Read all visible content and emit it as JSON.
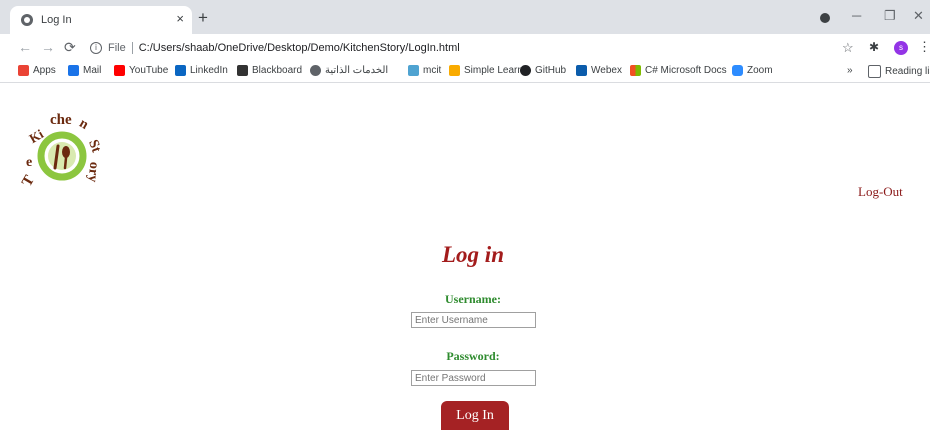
{
  "browser": {
    "tab_title": "Log In",
    "tab_close": "×",
    "new_tab": "+",
    "omnibox": {
      "scheme_label": "File",
      "url": "C:/Users/shaab/OneDrive/Desktop/Demo/KitchenStory/LogIn.html"
    },
    "bookmarks": [
      {
        "label": "Apps",
        "icon": "apps-grid-icon",
        "color": "#ea4335"
      },
      {
        "label": "Mail",
        "icon": "mail-icon",
        "color": "#1a73e8"
      },
      {
        "label": "YouTube",
        "icon": "youtube-icon",
        "color": "#ff0000"
      },
      {
        "label": "LinkedIn",
        "icon": "linkedin-icon",
        "color": "#0a66c2"
      },
      {
        "label": "Blackboard",
        "icon": "blackboard-icon",
        "color": "#333333"
      },
      {
        "label": "الخدمات الذاتية",
        "icon": "globe-icon",
        "color": "#5f6368"
      },
      {
        "label": "mcit",
        "icon": "mcit-icon",
        "color": "#4fa3d1"
      },
      {
        "label": "Simple Learn",
        "icon": "simplelearn-icon",
        "color": "#f9ab00"
      },
      {
        "label": "GitHub",
        "icon": "github-icon",
        "color": "#202124"
      },
      {
        "label": "Webex",
        "icon": "webex-icon",
        "color": "#0b5cab"
      },
      {
        "label": "C# Microsoft Docs",
        "icon": "microsoft-icon",
        "color": "#f25022"
      },
      {
        "label": "Zoom",
        "icon": "zoom-icon",
        "color": "#2d8cff"
      }
    ],
    "overflow": "»",
    "reading_list": "Reading list",
    "avatar_letter": "s"
  },
  "page": {
    "logo_text": "The Kitchen Story",
    "logout_label": "Log-Out",
    "heading": "Log in",
    "username_label": "Username:",
    "username_placeholder": "Enter Username",
    "password_label": "Password:",
    "password_placeholder": "Enter Password",
    "login_button": "Log In"
  },
  "colors": {
    "brand_red": "#a52224",
    "label_green": "#2e8b2e",
    "logo_green": "#8cc63f",
    "logo_brown": "#6b2a0f"
  }
}
